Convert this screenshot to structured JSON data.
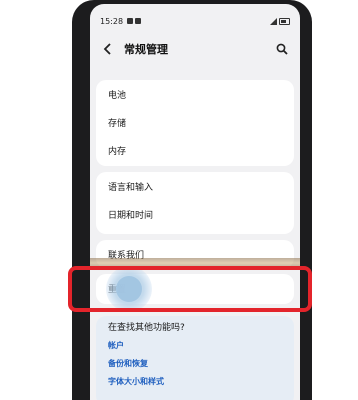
{
  "status_bar": {
    "time": "15:28"
  },
  "header": {
    "title": "常规管理",
    "back_icon": "chevron-left-icon",
    "search_icon": "search-icon"
  },
  "groups": [
    {
      "items": [
        "电池",
        "存储",
        "内存"
      ]
    },
    {
      "items": [
        "语言和输入",
        "日期和时间"
      ]
    },
    {
      "items": [
        "联系我们"
      ]
    },
    {
      "items": [
        "重置"
      ]
    }
  ],
  "suggestions": {
    "title": "在查找其他功能吗?",
    "links": [
      "帐户",
      "备份和恢复",
      "字体大小和样式"
    ]
  },
  "colors": {
    "highlight_border": "#e3242b",
    "link": "#1f5fbf",
    "screen_bg": "#f1f1f3",
    "suggestion_bg": "#e6edf5"
  }
}
